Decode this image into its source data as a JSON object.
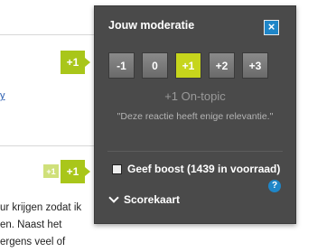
{
  "page": {
    "link_fragment": "y",
    "body_text": "ur krijgen zodat ik\nen. Naast het\nergens veel of"
  },
  "badges": {
    "top_score": "+1",
    "small_score": "+1",
    "bottom_score": "+1"
  },
  "moderation": {
    "title": "Jouw moderatie",
    "close_label": "×",
    "options": [
      "-1",
      "0",
      "+1",
      "+2",
      "+3"
    ],
    "selected": "+1",
    "current_label": "+1 On-topic",
    "current_description": "\"Deze reactie heeft enige relevantie.\"",
    "boost": {
      "label": "Geef boost (1439 in voorraad)",
      "checked": false
    },
    "help_label": "?",
    "scorecard_label": "Scorekaart"
  },
  "colors": {
    "panel_bg": "#4a4a4a",
    "accent_green": "#c6d51c",
    "badge_green": "#a9c61a",
    "close_blue": "#1f86c8"
  }
}
